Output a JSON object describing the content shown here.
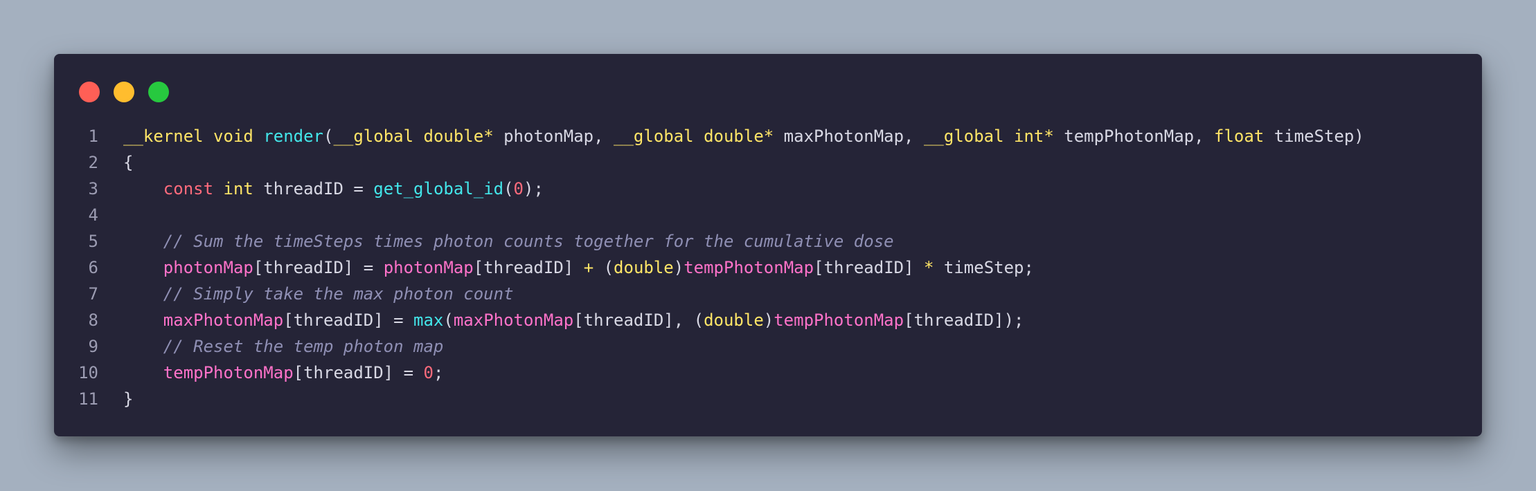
{
  "window": {
    "controls": [
      {
        "name": "close",
        "color": "#ff5f56"
      },
      {
        "name": "minimize",
        "color": "#ffbd2e"
      },
      {
        "name": "maximize",
        "color": "#27c93f"
      }
    ]
  },
  "code": {
    "lines": [
      {
        "num": "1",
        "tokens": [
          {
            "t": "__kernel void ",
            "c": "kw"
          },
          {
            "t": "render",
            "c": "fn"
          },
          {
            "t": "(",
            "c": "plain"
          },
          {
            "t": "__global double*",
            "c": "kw"
          },
          {
            "t": " photonMap, ",
            "c": "plain"
          },
          {
            "t": "__global double*",
            "c": "kw"
          },
          {
            "t": " maxPhotonMap, ",
            "c": "plain"
          },
          {
            "t": "__global int*",
            "c": "kw"
          },
          {
            "t": " tempPhotonMap, ",
            "c": "plain"
          },
          {
            "t": "float",
            "c": "kw"
          },
          {
            "t": " timeStep)",
            "c": "plain"
          }
        ]
      },
      {
        "num": "2",
        "tokens": [
          {
            "t": "{",
            "c": "plain"
          }
        ]
      },
      {
        "num": "3",
        "tokens": [
          {
            "t": "    ",
            "c": "plain"
          },
          {
            "t": "const",
            "c": "const"
          },
          {
            "t": " ",
            "c": "plain"
          },
          {
            "t": "int",
            "c": "kw"
          },
          {
            "t": " threadID = ",
            "c": "plain"
          },
          {
            "t": "get_global_id",
            "c": "fn"
          },
          {
            "t": "(",
            "c": "plain"
          },
          {
            "t": "0",
            "c": "num"
          },
          {
            "t": ");",
            "c": "plain"
          }
        ]
      },
      {
        "num": "4",
        "tokens": []
      },
      {
        "num": "5",
        "tokens": [
          {
            "t": "    ",
            "c": "plain"
          },
          {
            "t": "// Sum the timeSteps times photon counts together for the cumulative dose",
            "c": "comment"
          }
        ]
      },
      {
        "num": "6",
        "tokens": [
          {
            "t": "    ",
            "c": "plain"
          },
          {
            "t": "photonMap",
            "c": "var"
          },
          {
            "t": "[threadID] = ",
            "c": "plain"
          },
          {
            "t": "photonMap",
            "c": "var"
          },
          {
            "t": "[threadID] ",
            "c": "plain"
          },
          {
            "t": "+",
            "c": "kw"
          },
          {
            "t": " (",
            "c": "plain"
          },
          {
            "t": "double",
            "c": "kw"
          },
          {
            "t": ")",
            "c": "plain"
          },
          {
            "t": "tempPhotonMap",
            "c": "var"
          },
          {
            "t": "[threadID] ",
            "c": "plain"
          },
          {
            "t": "*",
            "c": "kw"
          },
          {
            "t": " timeStep;",
            "c": "plain"
          }
        ]
      },
      {
        "num": "7",
        "tokens": [
          {
            "t": "    ",
            "c": "plain"
          },
          {
            "t": "// Simply take the max photon count",
            "c": "comment"
          }
        ]
      },
      {
        "num": "8",
        "tokens": [
          {
            "t": "    ",
            "c": "plain"
          },
          {
            "t": "maxPhotonMap",
            "c": "var"
          },
          {
            "t": "[threadID] = ",
            "c": "plain"
          },
          {
            "t": "max",
            "c": "fn"
          },
          {
            "t": "(",
            "c": "plain"
          },
          {
            "t": "maxPhotonMap",
            "c": "var"
          },
          {
            "t": "[threadID], (",
            "c": "plain"
          },
          {
            "t": "double",
            "c": "kw"
          },
          {
            "t": ")",
            "c": "plain"
          },
          {
            "t": "tempPhotonMap",
            "c": "var"
          },
          {
            "t": "[threadID]);",
            "c": "plain"
          }
        ]
      },
      {
        "num": "9",
        "tokens": [
          {
            "t": "    ",
            "c": "plain"
          },
          {
            "t": "// Reset the temp photon map",
            "c": "comment"
          }
        ]
      },
      {
        "num": "10",
        "tokens": [
          {
            "t": "    ",
            "c": "plain"
          },
          {
            "t": "tempPhotonMap",
            "c": "var"
          },
          {
            "t": "[threadID] = ",
            "c": "plain"
          },
          {
            "t": "0",
            "c": "num"
          },
          {
            "t": ";",
            "c": "plain"
          }
        ]
      },
      {
        "num": "11",
        "tokens": [
          {
            "t": "}",
            "c": "plain"
          }
        ]
      }
    ]
  }
}
